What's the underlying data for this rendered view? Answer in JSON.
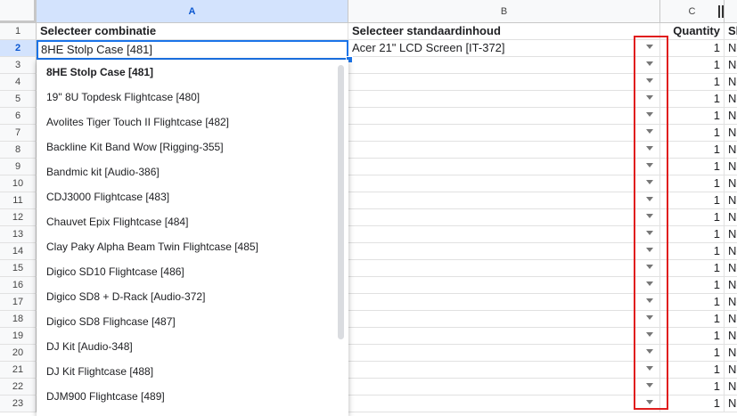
{
  "columns": [
    {
      "letter": "A",
      "selected": true
    },
    {
      "letter": "B",
      "selected": false
    },
    {
      "letter": "C",
      "selected": false
    }
  ],
  "header_row": {
    "a": "Selecteer combinatie",
    "b": "Selecteer standaardinhoud",
    "c": "Quantity",
    "d": "Sh"
  },
  "row2": {
    "a": "8HE Stolp Case [481]",
    "b": "Acer 21\" LCD Screen [IT-372]",
    "c": "1",
    "d": "No"
  },
  "row_numbers": [
    "1",
    "2",
    "3",
    "4",
    "5",
    "6",
    "7",
    "8",
    "9",
    "10",
    "11",
    "12",
    "13",
    "14",
    "15",
    "16",
    "17",
    "18",
    "19",
    "20",
    "21",
    "22",
    "23"
  ],
  "quantity_value": "1",
  "d_value": "No",
  "dropdown_items": [
    "8HE Stolp Case [481]",
    "19\" 8U Topdesk Flightcase [480]",
    "Avolites Tiger Touch II Flightcase [482]",
    "Backline Kit Band Wow [Rigging-355]",
    "Bandmic kit [Audio-386]",
    "CDJ3000 Flightcase [483]",
    "Chauvet Epix Flightcase [484]",
    "Clay Paky Alpha Beam Twin Flightcase [485]",
    "Digico SD10 Flightcase [486]",
    "Digico SD8 + D-Rack [Audio-372]",
    "Digico SD8 Flighcase [487]",
    "DJ Kit [Audio-348]",
    "DJ Kit Flightcase [488]",
    "DJM900 Flightcase [489]"
  ],
  "colors": {
    "selection": "#1a73e8",
    "highlight": "#e01e1e",
    "header_bg": "#f8f9fa"
  },
  "icons": {
    "dropdown": "triangle-down-icon",
    "freeze": "column-freeze-icon"
  }
}
